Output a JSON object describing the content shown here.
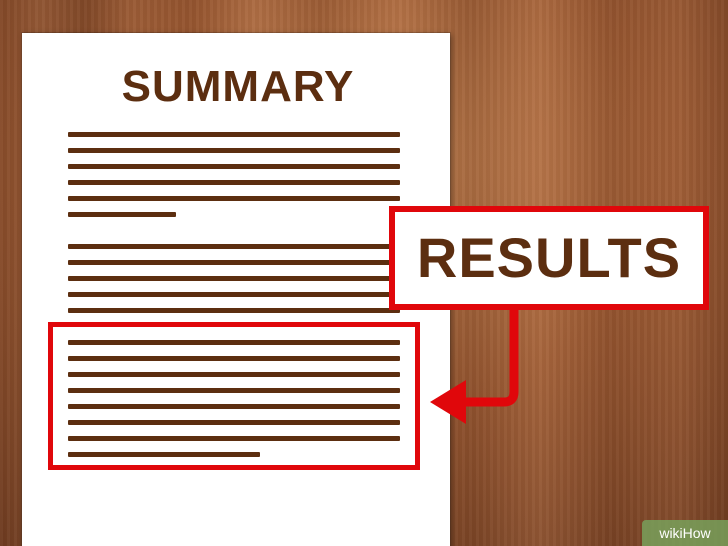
{
  "document": {
    "title": "SUMMARY"
  },
  "callout": {
    "label": "RESULTS",
    "color": "#e0070b"
  },
  "colors": {
    "text": "#5c2e10",
    "paper": "#ffffff",
    "highlight": "#e0070b"
  },
  "icons": {
    "callout_arrow": "arrow-left-icon"
  },
  "watermark": {
    "text": "wikiHow"
  }
}
